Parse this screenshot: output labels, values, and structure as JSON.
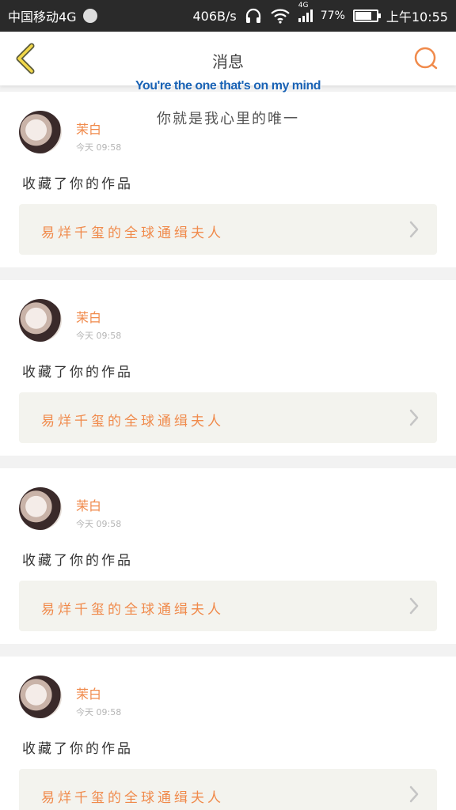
{
  "status_bar": {
    "carrier": "中国移动4G",
    "speed": "406B/s",
    "network": "4G",
    "battery": "77%",
    "battery_level": 0.77,
    "time": "上午10:55"
  },
  "header": {
    "title": "消息",
    "back_icon": "chevron-left-icon",
    "search_icon": "search-icon",
    "accent_color": "#f08a4b"
  },
  "overlay": {
    "lyric_en": "You're the one that's on my mind",
    "lyric_cn": "你就是我心里的唯一"
  },
  "messages": [
    {
      "name": "茉白",
      "time": "今天 09:58",
      "action": "收藏了你的作品",
      "work_title": "易烊千玺的全球通缉夫人"
    },
    {
      "name": "茉白",
      "time": "今天 09:58",
      "action": "收藏了你的作品",
      "work_title": "易烊千玺的全球通缉夫人"
    },
    {
      "name": "茉白",
      "time": "今天 09:58",
      "action": "收藏了你的作品",
      "work_title": "易烊千玺的全球通缉夫人"
    },
    {
      "name": "茉白",
      "time": "今天 09:58",
      "action": "收藏了你的作品",
      "work_title": "易烊千玺的全球通缉夫人"
    }
  ]
}
